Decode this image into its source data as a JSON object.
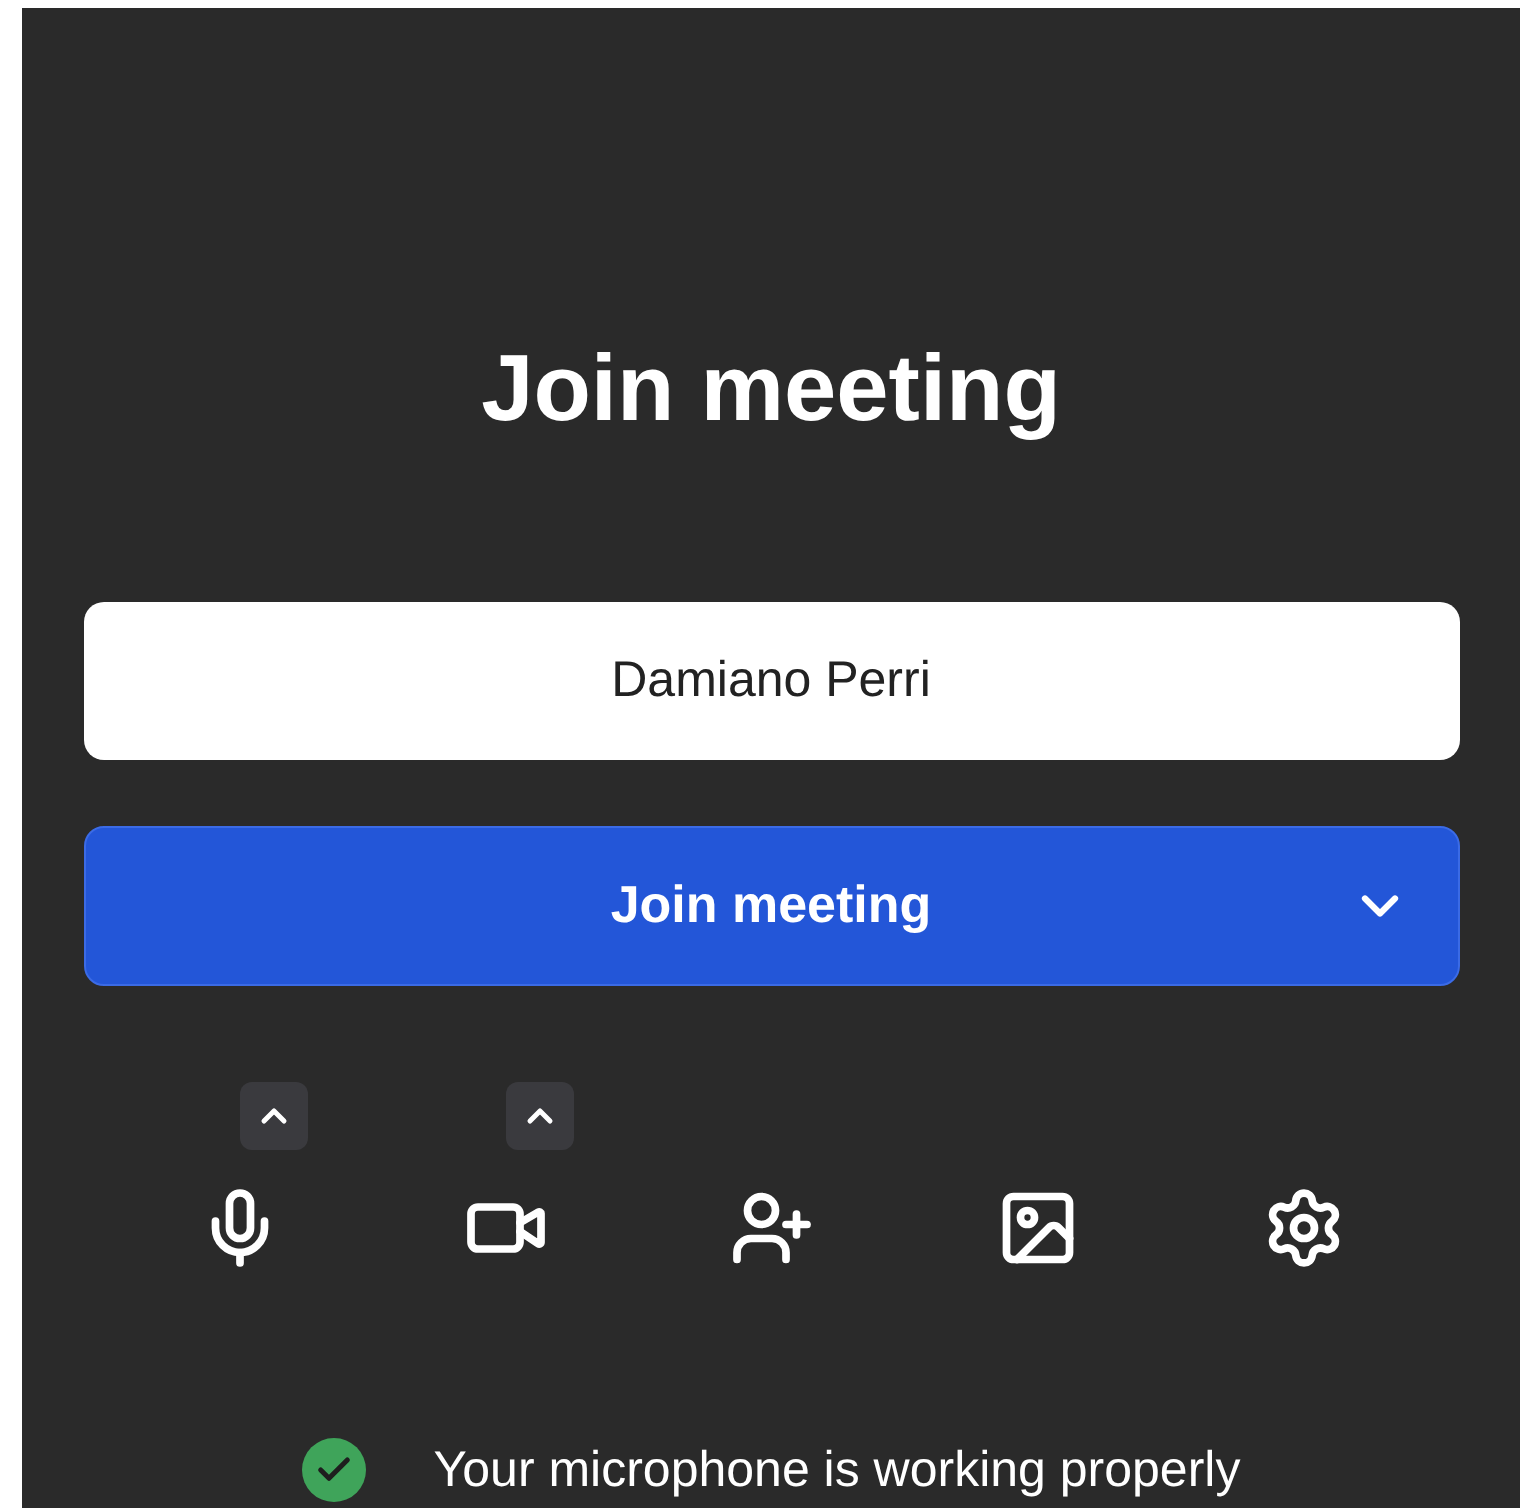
{
  "title": "Join meeting",
  "name_field": {
    "value": "Damiano Perri"
  },
  "join_button": {
    "label": "Join meeting",
    "has_menu": true
  },
  "toolbar": [
    {
      "kind": "microphone",
      "has_menu": true
    },
    {
      "kind": "camera",
      "has_menu": true
    },
    {
      "kind": "invite",
      "has_menu": false
    },
    {
      "kind": "background",
      "has_menu": false
    },
    {
      "kind": "settings",
      "has_menu": false
    }
  ],
  "status": {
    "ok": true,
    "text": "Your microphone is working properly"
  }
}
